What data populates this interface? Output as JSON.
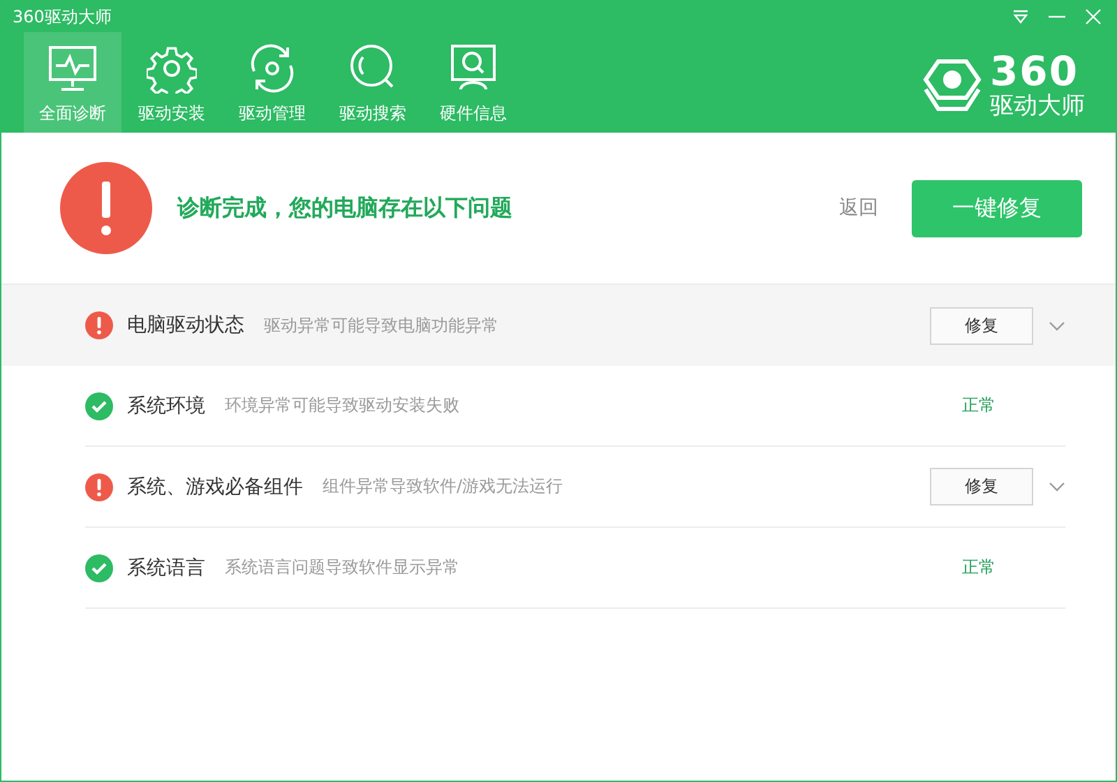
{
  "window": {
    "title": "360驱动大师"
  },
  "tabs": [
    {
      "label": "全面诊断",
      "kind": "diagnosis",
      "selected": true
    },
    {
      "label": "驱动安装",
      "kind": "install",
      "selected": false
    },
    {
      "label": "驱动管理",
      "kind": "manage",
      "selected": false
    },
    {
      "label": "驱动搜索",
      "kind": "find",
      "selected": false
    },
    {
      "label": "硬件信息",
      "kind": "hardware",
      "selected": false
    }
  ],
  "logo": {
    "number": "360",
    "name": "驱动大师"
  },
  "summary": {
    "heading": "诊断完成，您的电脑存在以下问题",
    "back_link": "返回",
    "fix_all_button": "一键修复"
  },
  "checks": [
    {
      "kind": "problem",
      "title": "电脑驱动状态",
      "description": "驱动异常可能导致电脑功能异常",
      "action": "修复",
      "selected": true
    },
    {
      "kind": "ok",
      "title": "系统环境",
      "description": "环境异常可能导致驱动安装失败",
      "status": "正常",
      "selected": false
    },
    {
      "kind": "problem",
      "title": "系统、游戏必备组件",
      "description": "组件异常导致软件/游戏无法运行",
      "action": "修复",
      "selected": false
    },
    {
      "kind": "ok",
      "title": "系统语言",
      "description": "系统语言问题导致软件显示异常",
      "status": "正常",
      "selected": false
    }
  ]
}
